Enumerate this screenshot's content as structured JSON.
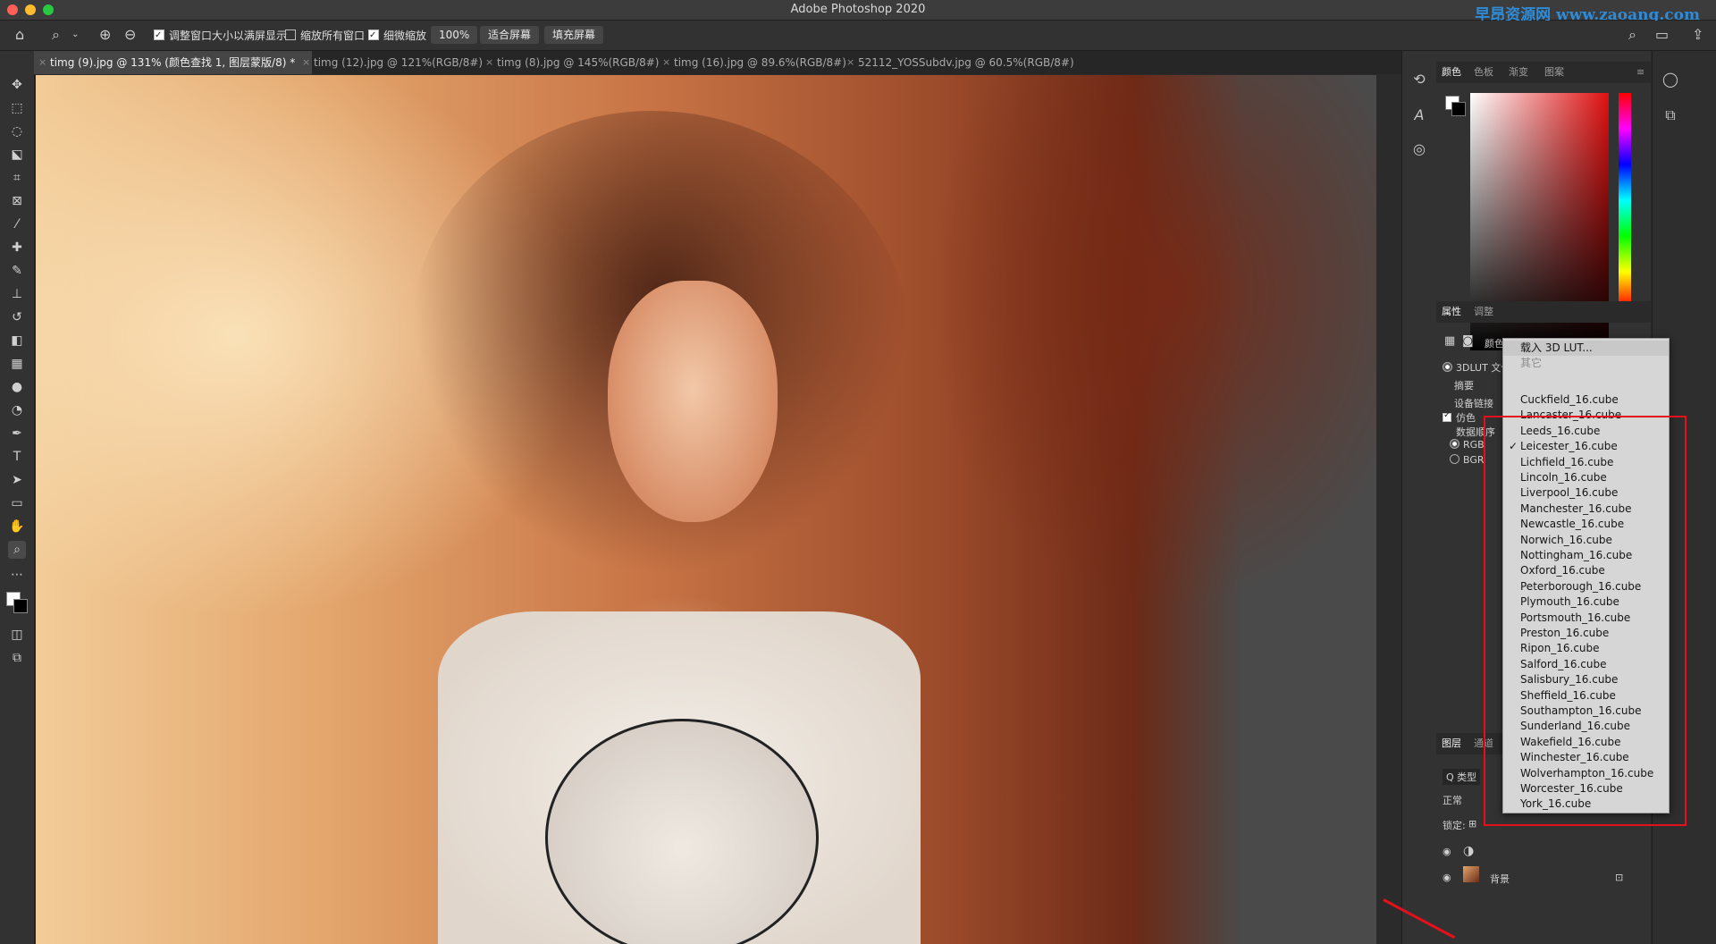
{
  "app": {
    "title": "Adobe Photoshop 2020",
    "watermark": "早昂资源网 www.zaoang.com"
  },
  "options_bar": {
    "resize_windows": "调整窗口大小以满屏显示",
    "zoom_all_windows": "缩放所有窗口",
    "scrubby_zoom": "细微缩放",
    "zoom_value": "100%",
    "fit_screen": "适合屏幕",
    "fill_screen": "填充屏幕"
  },
  "tabs": [
    {
      "label": "timg (9).jpg @ 131% (颜色查找 1, 图层蒙版/8) *",
      "active": true
    },
    {
      "label": "timg (12).jpg @ 121%(RGB/8#)",
      "active": false
    },
    {
      "label": "timg (8).jpg @ 145%(RGB/8#)",
      "active": false
    },
    {
      "label": "timg (16).jpg @ 89.6%(RGB/8#)",
      "active": false
    },
    {
      "label": "52112_YOSSubdv.jpg @ 60.5%(RGB/8#)",
      "active": false
    }
  ],
  "color_panel": {
    "tabs": [
      "颜色",
      "色板",
      "渐变",
      "图案"
    ]
  },
  "properties_panel": {
    "tabs": [
      "属性",
      "调整"
    ],
    "header_label": "颜色",
    "lut_file": "3DLUT 文件",
    "abstract": "摘要",
    "device_link": "设备链接",
    "dither": "仿色",
    "data_order": "数据顺序",
    "rgb": "RGB",
    "bgr": "BGR"
  },
  "layers_panel": {
    "tabs": [
      "图层",
      "通道"
    ],
    "kind": "Q 类型",
    "blend_mode": "正常",
    "lock": "锁定:",
    "background_layer": "背景"
  },
  "lut_menu": {
    "load": "载入 3D LUT...",
    "other": "其它",
    "selected": "Leicester_16.cube",
    "items": [
      "Cuckfield_16.cube",
      "Lancaster_16.cube",
      "Leeds_16.cube",
      "Leicester_16.cube",
      "Lichfield_16.cube",
      "Lincoln_16.cube",
      "Liverpool_16.cube",
      "Manchester_16.cube",
      "Newcastle_16.cube",
      "Norwich_16.cube",
      "Nottingham_16.cube",
      "Oxford_16.cube",
      "Peterborough_16.cube",
      "Plymouth_16.cube",
      "Portsmouth_16.cube",
      "Preston_16.cube",
      "Ripon_16.cube",
      "Salford_16.cube",
      "Salisbury_16.cube",
      "Sheffield_16.cube",
      "Southampton_16.cube",
      "Sunderland_16.cube",
      "Wakefield_16.cube",
      "Winchester_16.cube",
      "Wolverhampton_16.cube",
      "Worcester_16.cube",
      "York_16.cube"
    ]
  },
  "colors": {
    "annotation": "#e4101c",
    "watermark": "#2e8bd8"
  }
}
